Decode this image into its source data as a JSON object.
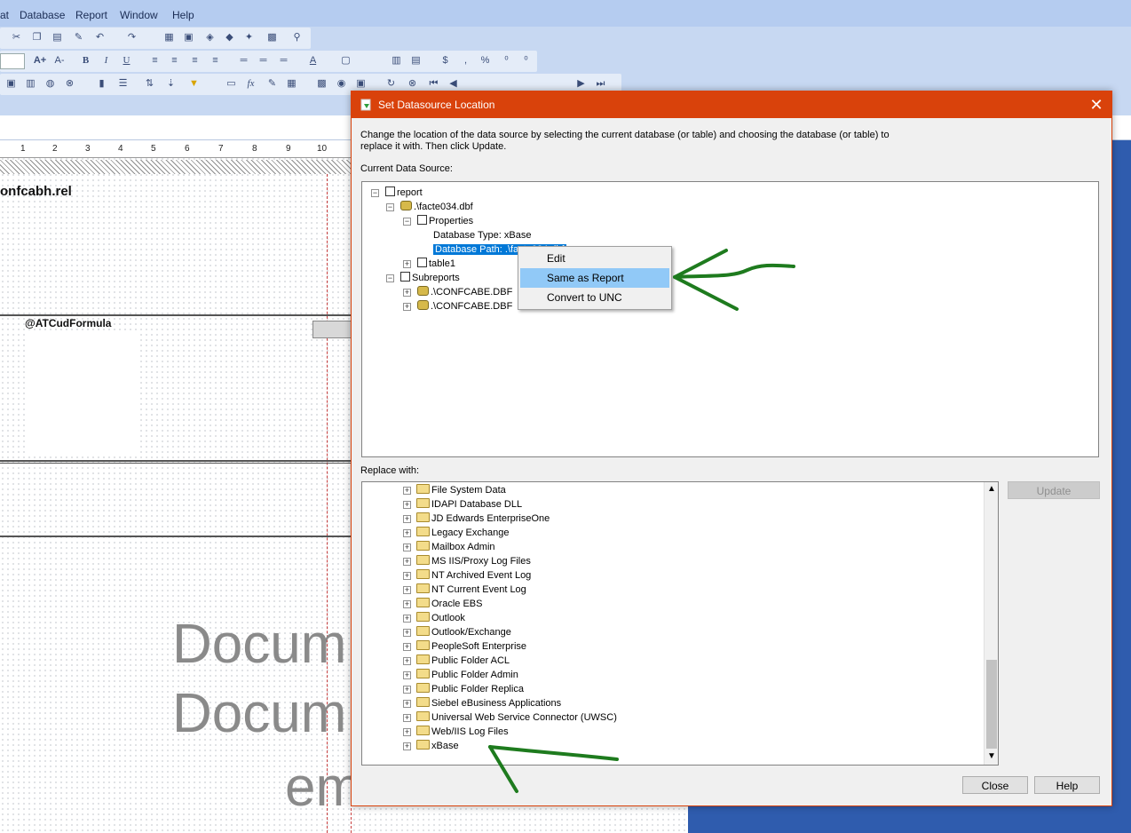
{
  "menu": [
    "at",
    "Database",
    "Report",
    "Window",
    "Help"
  ],
  "toolbar": {
    "combo_value": "",
    "font_buttons": [
      "A+",
      "A-",
      "B",
      "I",
      "U"
    ],
    "format_symbols": [
      "$",
      ",",
      "%"
    ],
    "fx_label": "fx"
  },
  "canvas": {
    "ruler_numbers": [
      "1",
      "2",
      "3",
      "4",
      "5",
      "6",
      "7",
      "8",
      "9",
      "10"
    ],
    "field_top": "onfcabh.rel",
    "field_formula": "@ATCudFormula",
    "watermark": [
      "Docum",
      "Docum",
      "em"
    ]
  },
  "dialog": {
    "title": "Set Datasource Location",
    "close_glyph": "✕",
    "instruction": "Change the location of the data source by selecting the current database (or table) and choosing the database (or table) to replace it with.  Then click Update.",
    "current_label": "Current Data Source:",
    "replace_label": "Replace with:",
    "current_tree": [
      {
        "label": "report",
        "level": 0,
        "expander": "−",
        "icon": "report"
      },
      {
        "label": ".\\facte034.dbf",
        "level": 1,
        "expander": "−",
        "icon": "db"
      },
      {
        "label": "Properties",
        "level": 2,
        "expander": "−",
        "icon": "props"
      },
      {
        "label": "Database Type: xBase",
        "level": 3,
        "expander": "",
        "icon": ""
      },
      {
        "label": "Database Path: .\\facte034.dbf",
        "level": 3,
        "expander": "",
        "icon": "",
        "selected": true
      },
      {
        "label": "table1",
        "level": 2,
        "expander": "+",
        "icon": "table"
      },
      {
        "label": "Subreports",
        "level": 1,
        "expander": "−",
        "icon": "sub"
      },
      {
        "label": ".\\CONFCABE.DBF",
        "level": 2,
        "expander": "+",
        "icon": "db"
      },
      {
        "label": ".\\CONFCABE.DBF",
        "level": 2,
        "expander": "+",
        "icon": "db"
      }
    ],
    "context_menu": [
      {
        "label": "Edit",
        "highlighted": false
      },
      {
        "label": "Same as Report",
        "highlighted": true
      },
      {
        "label": "Convert to UNC",
        "highlighted": false
      }
    ],
    "replace_tree": [
      "File System Data",
      "IDAPI Database DLL",
      "JD Edwards EnterpriseOne",
      "Legacy Exchange",
      "Mailbox Admin",
      "MS IIS/Proxy Log Files",
      "NT Archived Event Log",
      "NT Current Event Log",
      "Oracle EBS",
      "Outlook",
      "Outlook/Exchange",
      "PeopleSoft Enterprise",
      "Public Folder ACL",
      "Public Folder Admin",
      "Public Folder Replica",
      "Siebel eBusiness Applications",
      "Universal Web Service Connector (UWSC)",
      "Web/IIS Log Files",
      "xBase"
    ],
    "buttons": {
      "update": "Update",
      "close": "Close",
      "help": "Help"
    },
    "colors": {
      "title_bar": "#d9420b",
      "selection": "#0078d7",
      "annotation_arrow": "#1e7b1e"
    }
  }
}
